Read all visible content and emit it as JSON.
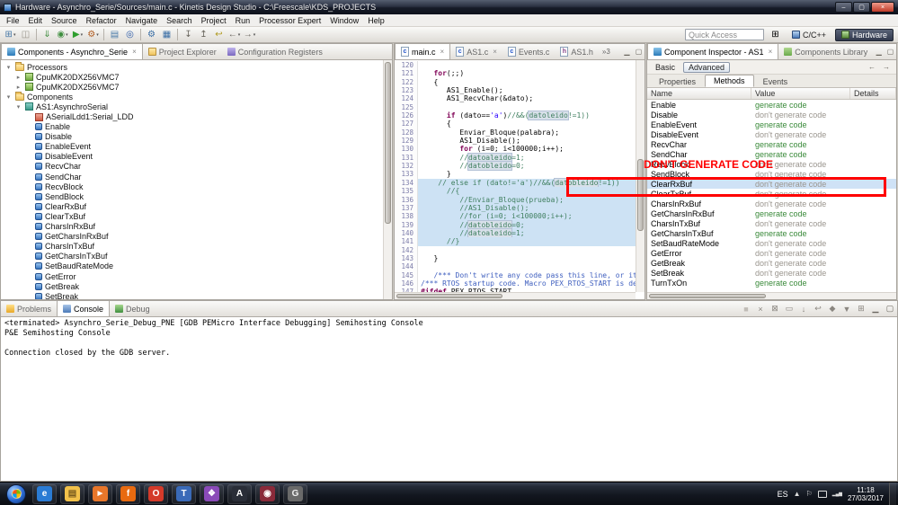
{
  "window": {
    "title": "Hardware - Asynchro_Serie/Sources/main.c - Kinetis Design Studio - C:\\Freescale\\KDS_PROJECTS",
    "controls": {
      "minimize": "–",
      "maximize": "▢",
      "close": "×"
    }
  },
  "menubar": {
    "items": [
      "File",
      "Edit",
      "Source",
      "Refactor",
      "Navigate",
      "Search",
      "Project",
      "Run",
      "Processor Expert",
      "Window",
      "Help"
    ]
  },
  "toolbar": {
    "quick_access": "Quick Access",
    "open_perspective_glyph": "⊞",
    "perspectives": [
      {
        "label": "C/C++",
        "active": false
      },
      {
        "label": "Hardware",
        "active": true
      }
    ],
    "icons": [
      {
        "name": "new",
        "glyph": "⊞",
        "color": "#4a7aa8",
        "dd": true
      },
      {
        "name": "save",
        "glyph": "◫",
        "color": "#9a968e"
      },
      {
        "sep": true
      },
      {
        "name": "flash-download",
        "glyph": "⇓",
        "color": "#3a8a3a"
      },
      {
        "name": "debug",
        "glyph": "◉",
        "color": "#3f8f3f",
        "dd": true
      },
      {
        "name": "run",
        "glyph": "▶",
        "color": "#2e9e2e",
        "dd": true
      },
      {
        "name": "external-tools",
        "glyph": "⚙",
        "color": "#b05c20",
        "dd": true
      },
      {
        "sep": true
      },
      {
        "name": "new-c-file",
        "glyph": "▤",
        "color": "#4a7aa8"
      },
      {
        "name": "search",
        "glyph": "◎",
        "color": "#2a5aa8"
      },
      {
        "sep": true
      },
      {
        "name": "pe-generate-code",
        "glyph": "⚙",
        "color": "#3a6ea5"
      },
      {
        "name": "pe-components",
        "glyph": "▦",
        "color": "#3a6ea5"
      },
      {
        "sep": true
      },
      {
        "name": "next-annotation",
        "glyph": "↧",
        "color": "#6a665e"
      },
      {
        "name": "previous-annotation",
        "glyph": "↥",
        "color": "#6a665e"
      },
      {
        "name": "last-edit-location",
        "glyph": "↩",
        "color": "#b09a20"
      },
      {
        "name": "back",
        "glyph": "←",
        "color": "#6a665e",
        "dd": true
      },
      {
        "name": "forward",
        "glyph": "→",
        "color": "#6a665e",
        "dd": true
      }
    ]
  },
  "left_panel": {
    "tabs": [
      {
        "label": "Components - Asynchro_Serie",
        "active": true,
        "closable": true,
        "icon": "components"
      },
      {
        "label": "Project Explorer",
        "active": false,
        "icon": "explorer"
      },
      {
        "label": "Configuration Registers",
        "active": false,
        "icon": "registers"
      }
    ],
    "tree": [
      {
        "label": "Processors",
        "depth": 0,
        "icon": "folder",
        "exp": "open"
      },
      {
        "label": "CpuMK20DX256VMC7",
        "depth": 1,
        "icon": "cpu",
        "exp": "closed"
      },
      {
        "label": "CpuMK20DX256VMC7",
        "depth": 1,
        "icon": "cpu",
        "exp": "closed"
      },
      {
        "label": "Components",
        "depth": 0,
        "icon": "folder",
        "exp": "open"
      },
      {
        "label": "AS1:AsynchroSerial",
        "depth": 1,
        "icon": "component",
        "exp": "open"
      },
      {
        "label": "ASerialLdd1:Serial_LDD",
        "depth": 2,
        "icon": "ldd"
      },
      {
        "label": "Enable",
        "depth": 2,
        "icon": "method"
      },
      {
        "label": "Disable",
        "depth": 2,
        "icon": "method"
      },
      {
        "label": "EnableEvent",
        "depth": 2,
        "icon": "method"
      },
      {
        "label": "DisableEvent",
        "depth": 2,
        "icon": "method"
      },
      {
        "label": "RecvChar",
        "depth": 2,
        "icon": "method"
      },
      {
        "label": "SendChar",
        "depth": 2,
        "icon": "method"
      },
      {
        "label": "RecvBlock",
        "depth": 2,
        "icon": "method"
      },
      {
        "label": "SendBlock",
        "depth": 2,
        "icon": "method"
      },
      {
        "label": "ClearRxBuf",
        "depth": 2,
        "icon": "method"
      },
      {
        "label": "ClearTxBuf",
        "depth": 2,
        "icon": "method"
      },
      {
        "label": "CharsInRxBuf",
        "depth": 2,
        "icon": "method"
      },
      {
        "label": "GetCharsInRxBuf",
        "depth": 2,
        "icon": "method"
      },
      {
        "label": "CharsInTxBuf",
        "depth": 2,
        "icon": "method"
      },
      {
        "label": "GetCharsInTxBuf",
        "depth": 2,
        "icon": "method"
      },
      {
        "label": "SetBaudRateMode",
        "depth": 2,
        "icon": "method"
      },
      {
        "label": "GetError",
        "depth": 2,
        "icon": "method"
      },
      {
        "label": "GetBreak",
        "depth": 2,
        "icon": "method"
      },
      {
        "label": "SetBreak",
        "depth": 2,
        "icon": "method"
      }
    ]
  },
  "editor": {
    "tabs": [
      {
        "label": "main.c",
        "active": true,
        "closable": true,
        "kind": "c"
      },
      {
        "label": "AS1.c",
        "active": false,
        "closable": true,
        "kind": "c"
      },
      {
        "label": "Events.c",
        "active": false,
        "kind": "c"
      },
      {
        "label": "AS1.h",
        "active": false,
        "kind": "h"
      }
    ],
    "overflow_badge": "»3",
    "lines": [
      {
        "n": 120,
        "t": ""
      },
      {
        "n": 121,
        "t": "   for(;;)"
      },
      {
        "n": 122,
        "t": "   {"
      },
      {
        "n": 123,
        "t": "      AS1_Enable();"
      },
      {
        "n": 124,
        "t": "      AS1_RecvChar(&dato);"
      },
      {
        "n": 125,
        "t": ""
      },
      {
        "n": 126,
        "t": "      if (dato=='a')//&&(datoleido!=1))"
      },
      {
        "n": 127,
        "t": "      {"
      },
      {
        "n": 128,
        "t": "         Enviar_Bloque(palabra);"
      },
      {
        "n": 129,
        "t": "         AS1_Disable();"
      },
      {
        "n": 130,
        "t": "         for (i=0; i<100000;i++);"
      },
      {
        "n": 131,
        "t": "         //datoaleido=1;"
      },
      {
        "n": 132,
        "t": "         //datobleido=0;"
      },
      {
        "n": 133,
        "t": "      }"
      },
      {
        "n": 134,
        "t": "    // else if (dato!='a')//&&(datobleido!=1))",
        "hl": true
      },
      {
        "n": 135,
        "t": "      //{",
        "hl": true
      },
      {
        "n": 136,
        "t": "         //Enviar_Bloque(prueba);",
        "hl": true
      },
      {
        "n": 137,
        "t": "         //AS1_Disable();",
        "hl": true
      },
      {
        "n": 138,
        "t": "         //for (i=0; i<100000;i++);",
        "hl": true
      },
      {
        "n": 139,
        "t": "         //datobleido=0;",
        "hl": true
      },
      {
        "n": 140,
        "t": "         //datoaleido=1;",
        "hl": true
      },
      {
        "n": 141,
        "t": "      //}",
        "hl": true
      },
      {
        "n": 142,
        "t": ""
      },
      {
        "n": 143,
        "t": "   }"
      },
      {
        "n": 144,
        "t": ""
      },
      {
        "n": 145,
        "t": "   /*** Don't write any code pass this line, or it wi"
      },
      {
        "n": 146,
        "t": "/*** RTOS startup code. Macro PEX_RTOS_START is de"
      },
      {
        "n": 147,
        "t": "#ifdef PEX_RTOS_START"
      }
    ]
  },
  "right_panel": {
    "tabs": [
      {
        "label": "Component Inspector - AS1",
        "active": true,
        "closable": true,
        "icon": "inspector"
      },
      {
        "label": "Components Library",
        "active": false,
        "icon": "library"
      }
    ],
    "mode_basic": "Basic",
    "mode_advanced": "Advanced",
    "nav_icons": [
      {
        "name": "back",
        "glyph": "←"
      },
      {
        "name": "forward",
        "glyph": "→"
      }
    ],
    "inner_tabs": [
      {
        "label": "Properties",
        "active": false
      },
      {
        "label": "Methods",
        "active": true
      },
      {
        "label": "Events",
        "active": false
      }
    ],
    "columns": [
      "Name",
      "Value",
      "Details"
    ],
    "value_colors": {
      "generate": "#3a8a3a",
      "dont_generate": "#9a958e"
    },
    "rows": [
      {
        "name": "Enable",
        "value": "generate code",
        "generate": true
      },
      {
        "name": "Disable",
        "value": "don't generate code",
        "generate": false
      },
      {
        "name": "EnableEvent",
        "value": "generate code",
        "generate": true
      },
      {
        "name": "DisableEvent",
        "value": "don't generate code",
        "generate": false
      },
      {
        "name": "RecvChar",
        "value": "generate code",
        "generate": true
      },
      {
        "name": "SendChar",
        "value": "generate code",
        "generate": true
      },
      {
        "name": "RecvBlock",
        "value": "don't generate code",
        "generate": false
      },
      {
        "name": "SendBlock",
        "value": "don't generate code",
        "generate": false
      },
      {
        "name": "ClearRxBuf",
        "value": "don't generate code",
        "generate": false,
        "selected": true
      },
      {
        "name": "ClearTxBuf",
        "value": "don't generate code",
        "generate": false
      },
      {
        "name": "CharsInRxBuf",
        "value": "don't generate code",
        "generate": false
      },
      {
        "name": "GetCharsInRxBuf",
        "value": "generate code",
        "generate": true
      },
      {
        "name": "CharsInTxBuf",
        "value": "don't generate code",
        "generate": false
      },
      {
        "name": "GetCharsInTxBuf",
        "value": "generate code",
        "generate": true
      },
      {
        "name": "SetBaudRateMode",
        "value": "don't generate code",
        "generate": false
      },
      {
        "name": "GetError",
        "value": "don't generate code",
        "generate": false
      },
      {
        "name": "GetBreak",
        "value": "don't generate code",
        "generate": false
      },
      {
        "name": "SetBreak",
        "value": "don't generate code",
        "generate": false
      },
      {
        "name": "TurnTxOn",
        "value": "generate code",
        "generate": true
      }
    ]
  },
  "annotation": {
    "label": "DON'T GENERATE CODE",
    "color": "#ff0000"
  },
  "console_panel": {
    "tabs": [
      {
        "label": "Problems",
        "active": false,
        "icon": "problems"
      },
      {
        "label": "Console",
        "active": true,
        "icon": "console"
      },
      {
        "label": "Debug",
        "active": false,
        "icon": "debug"
      }
    ],
    "toolbar_icons": [
      {
        "name": "terminate",
        "glyph": "■",
        "color": "#c0bcb6"
      },
      {
        "name": "remove-launch",
        "glyph": "×",
        "color": "#8a8680"
      },
      {
        "name": "remove-all-launches",
        "glyph": "⊠",
        "color": "#8a8680"
      },
      {
        "name": "clear-console",
        "glyph": "▭",
        "color": "#8a8680"
      },
      {
        "name": "scroll-lock",
        "glyph": "↓",
        "color": "#8a8680"
      },
      {
        "name": "word-wrap",
        "glyph": "↩",
        "color": "#8a8680"
      },
      {
        "name": "pin-console",
        "glyph": "◆",
        "color": "#8a8680"
      },
      {
        "name": "display-selected-console",
        "glyph": "▼",
        "color": "#8a8680"
      },
      {
        "name": "open-console",
        "glyph": "⊞",
        "color": "#8a8680"
      },
      {
        "name": "minimize-view",
        "glyph": "▁",
        "color": "#6a665e"
      },
      {
        "name": "maximize-view",
        "glyph": "▢",
        "color": "#6a665e"
      }
    ],
    "lines": [
      "<terminated> Asynchro_Serie_Debug_PNE [GDB PEMicro Interface Debugging] Semihosting Console",
      "P&E Semihosting Console",
      "",
      "Connection closed by the GDB server."
    ]
  },
  "taskbar": {
    "apps": [
      {
        "name": "internet-explorer",
        "glyph": "e",
        "fg": "#ffffff",
        "bg": "#2a7bd4"
      },
      {
        "name": "windows-explorer",
        "glyph": "▤",
        "fg": "#7a5c1e",
        "bg": "#f2c14a"
      },
      {
        "name": "media-player",
        "glyph": "►",
        "fg": "#ffffff",
        "bg": "#e8762a"
      },
      {
        "name": "firefox",
        "glyph": "f",
        "fg": "#ffffff",
        "bg": "#e86a10"
      },
      {
        "name": "opera",
        "glyph": "O",
        "fg": "#ffffff",
        "bg": "#d43a2a"
      },
      {
        "name": "thunderbird",
        "glyph": "T",
        "fg": "#ffffff",
        "bg": "#3a6ab8"
      },
      {
        "name": "office",
        "glyph": "❖",
        "fg": "#ffffff",
        "bg": "#8a4ab8"
      },
      {
        "name": "kds",
        "glyph": "A",
        "fg": "#ffffff",
        "bg": "#2a2e38"
      },
      {
        "name": "app-red",
        "glyph": "◉",
        "fg": "#ffffff",
        "bg": "#8a2a3a"
      },
      {
        "name": "gimp",
        "glyph": "G",
        "fg": "#f0f0f0",
        "bg": "#6a6a6a"
      }
    ],
    "tray": {
      "language": "ES",
      "time": "11:18",
      "date": "27/03/2017"
    }
  }
}
